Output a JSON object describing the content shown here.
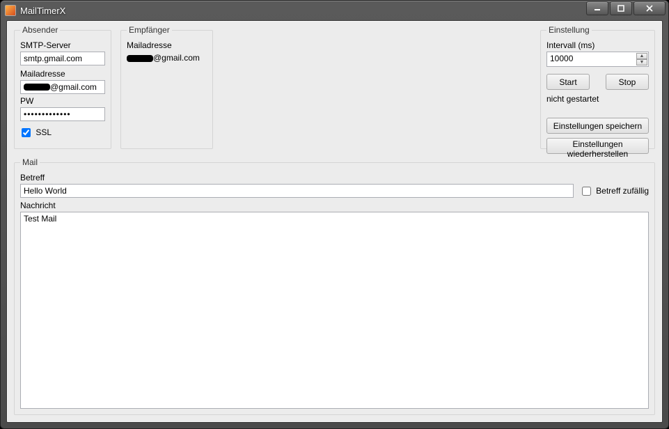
{
  "window": {
    "title": "MailTimerX"
  },
  "absender": {
    "legend": "Absender",
    "smtp_label": "SMTP-Server",
    "smtp_value": "smtp.gmail.com",
    "mail_label": "Mailadresse",
    "mail_suffix": "@gmail.com",
    "pw_label": "PW",
    "pw_value": "●●●●●●●●●●●●●",
    "ssl_label": "SSL",
    "ssl_checked": true
  },
  "empfaenger": {
    "legend": "Empfänger",
    "mail_label": "Mailadresse",
    "mail_suffix": "@gmail.com"
  },
  "einstellung": {
    "legend": "Einstellung",
    "interval_label": "Intervall (ms)",
    "interval_value": "10000",
    "start_label": "Start",
    "stop_label": "Stop",
    "status_text": "nicht gestartet",
    "save_label": "Einstellungen speichern",
    "restore_label": "Einstellungen wiederherstellen"
  },
  "mail": {
    "legend": "Mail",
    "betreff_label": "Betreff",
    "betreff_value": "Hello World",
    "zufaellig_label": "Betreff zufällig",
    "zufaellig_checked": false,
    "nachricht_label": "Nachricht",
    "nachricht_value": "Test Mail"
  }
}
